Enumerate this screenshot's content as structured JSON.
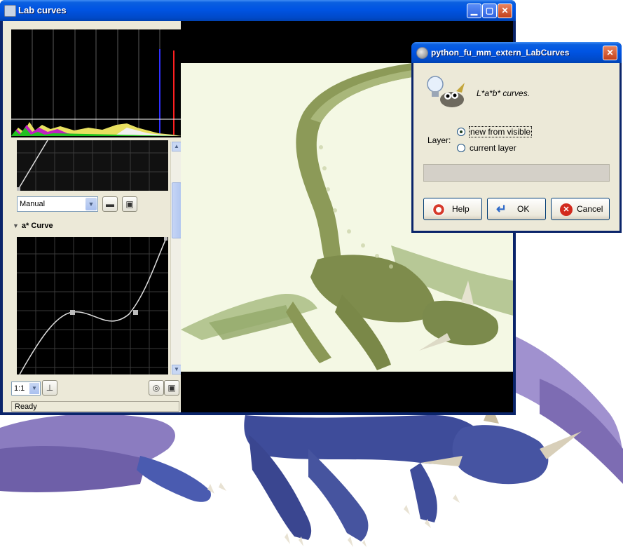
{
  "lab_window": {
    "title": "Lab curves",
    "mode_select": "Manual",
    "section_label": "a* Curve",
    "zoom_select": "1:1",
    "status": "Ready"
  },
  "dialog": {
    "title": "python_fu_mm_extern_LabCurves",
    "message": "L*a*b* curves.",
    "layer_label": "Layer:",
    "options": [
      "new from visible",
      "current layer"
    ],
    "selected_option": "new from visible",
    "buttons": {
      "help": "Help",
      "ok": "OK",
      "cancel": "Cancel"
    }
  },
  "icons": [
    "app-icon",
    "minimize-icon",
    "maximize-icon",
    "close-icon",
    "open-folder-icon",
    "save-icon",
    "pick-icon",
    "reset-icon",
    "lightbulb-icon",
    "gimp-wilber-icon",
    "help-lifebuoy-icon",
    "ok-arrow-icon",
    "cancel-x-icon"
  ],
  "colors": {
    "xp_title": "#0054e3",
    "dialog_face": "#ece9d8",
    "preview_tint": "#f4f8e4",
    "dragon_blue": "#4a5bb0",
    "wing_purple": "#9a86c7",
    "dragon_green": "#8e9c5a"
  }
}
